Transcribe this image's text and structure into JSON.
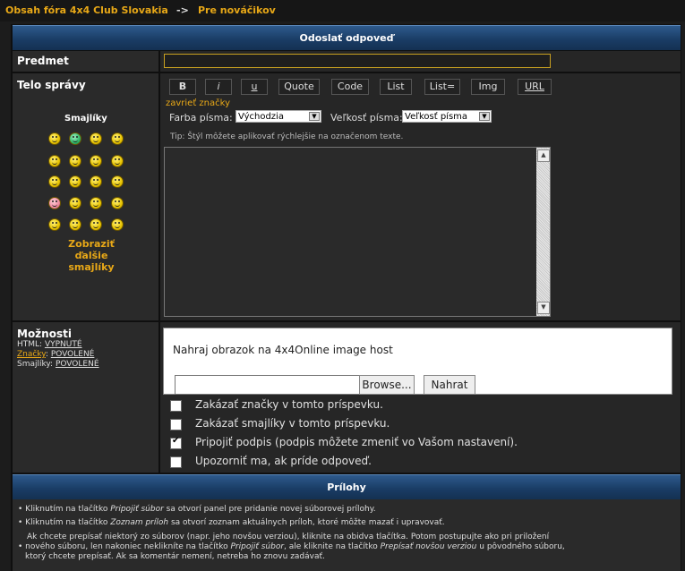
{
  "breadcrumb": {
    "forum": "Obsah fóra 4x4 Club Slovakia",
    "sep": " -> ",
    "section": "Pre nováčikov"
  },
  "header": {
    "title": "Odoslať odpoveď"
  },
  "subject": {
    "label": "Predmet",
    "value": ""
  },
  "body": {
    "label": "Telo správy"
  },
  "toolbar": [
    {
      "label": "B"
    },
    {
      "label": "i"
    },
    {
      "label": "u"
    },
    {
      "label": "Quote"
    },
    {
      "label": "Code"
    },
    {
      "label": "List"
    },
    {
      "label": "List="
    },
    {
      "label": "Img"
    },
    {
      "label": "URL"
    }
  ],
  "close_tags": "zavrieť značky",
  "font_color": {
    "label": "Farba písma:",
    "selected": "Východzia"
  },
  "font_size": {
    "label": "Veľkosť písma:",
    "selected": "Veľkosť písma"
  },
  "tip": "Tip: Štýl môžete aplikovať rýchlejšie na označenom texte.",
  "smileys": {
    "title": "Smajlíky",
    "more": "Zobraziť ďalšie smajlíky"
  },
  "options": {
    "title": "Možnosti",
    "html_label": "HTML: ",
    "html_value": "VYPNUTÉ",
    "tags_label": "Značky",
    "tags_value": "POVOLENÉ",
    "smileys_label": "Smajlíky: ",
    "smileys_value": "POVOLENÉ"
  },
  "upload": {
    "title": "Nahraj obrazok na 4x4Online image host",
    "browse": "Browse...",
    "submit": "Nahrat"
  },
  "checkboxes": [
    {
      "label": "Zakázať značky v tomto príspevku.",
      "checked": false
    },
    {
      "label": "Zakázať smajlíky v tomto príspevku.",
      "checked": false
    },
    {
      "label": "Pripojiť podpis (podpis môžete zmeniť vo Vašom nastavení).",
      "checked": true
    },
    {
      "label": "Upozorniť ma, ak príde odpoveď.",
      "checked": false
    }
  ],
  "attachments": {
    "title": "Prílohy",
    "l1a": "• Kliknutím na tlačítko ",
    "l1b": "Pripojiť súbor",
    "l1c": " sa otvorí panel pre pridanie novej súborovej prílohy.",
    "l2a": "• Kliknutím na tlačítko ",
    "l2b": "Zoznam príloh",
    "l2c": " sa otvorí zoznam aktuálnych príloh, ktoré môžte mazať i upravovať.",
    "l3": "Ak chcete prepísať niektorý zo súborov (napr. jeho novšou verziou), kliknite na obidva tlačítka. Potom postupujte ako pri priložení",
    "l4a": "• nového súboru, len nakoniec neklikníte na tlačítko ",
    "l4b": "Pripojiť súbor",
    "l4c": ", ale kliknite na tlačítko ",
    "l4d": "Prepísať novšou verziou",
    "l4e": " u pôvodného súboru,",
    "l5": "ktorý chcete prepísať. Ak sa komentár nemení, netreba ho znovu zadávať."
  }
}
